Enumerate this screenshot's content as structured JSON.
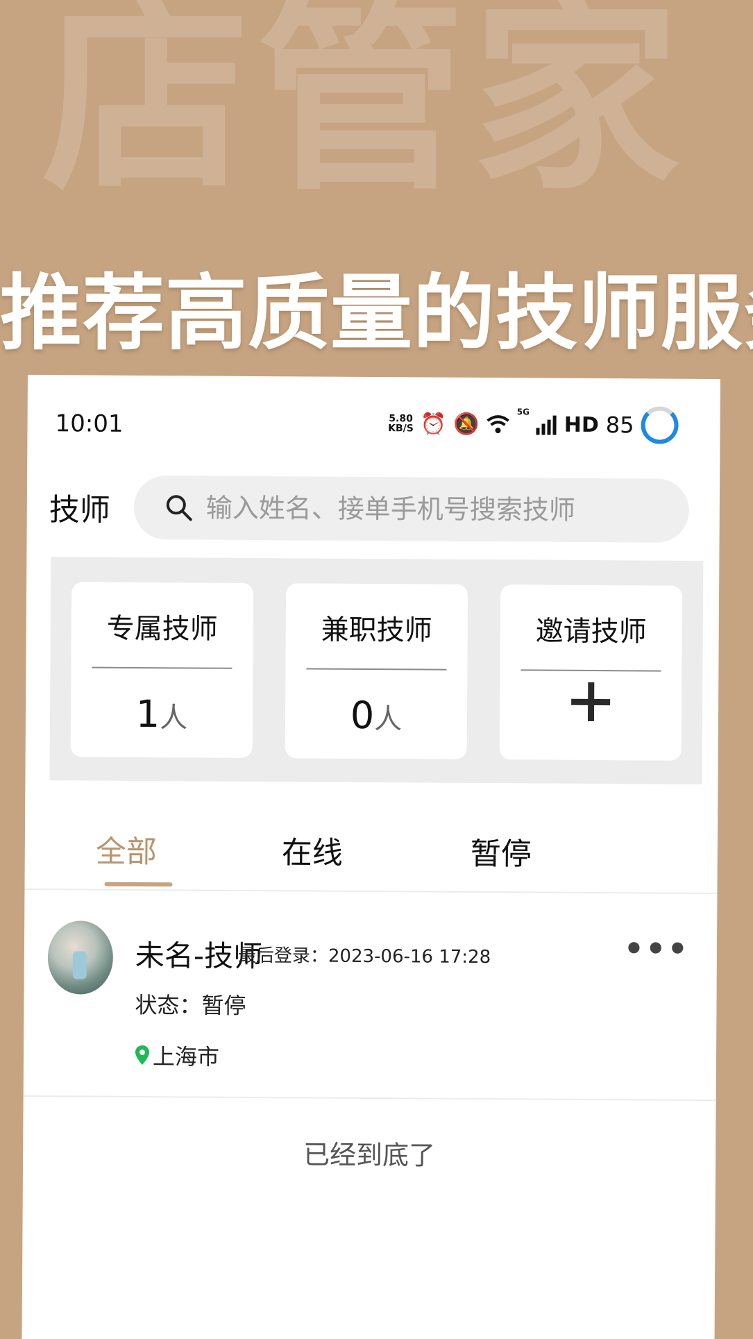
{
  "promo": {
    "watermark": "店管家",
    "headline": "推荐高质量的技师服务"
  },
  "status_bar": {
    "time": "10:01",
    "net_speed_value": "5.80",
    "net_speed_unit": "KB/S",
    "network": "5G",
    "hd": "HD",
    "battery": "85",
    "icons": [
      "alarm-icon",
      "silent-bell-icon",
      "wifi-icon",
      "signal-icon",
      "battery-ring-icon"
    ]
  },
  "header": {
    "title": "技师",
    "search_placeholder": "输入姓名、接单手机号搜索技师"
  },
  "stats": {
    "exclusive": {
      "label": "专属技师",
      "value": "1",
      "unit": "人"
    },
    "part_time": {
      "label": "兼职技师",
      "value": "0",
      "unit": "人"
    },
    "invite": {
      "label": "邀请技师"
    }
  },
  "tabs": [
    {
      "label": "全部",
      "active": true
    },
    {
      "label": "在线",
      "active": false
    },
    {
      "label": "暂停",
      "active": false
    }
  ],
  "technicians": [
    {
      "name": "未名-技师",
      "last_login_label": "最后登录：",
      "last_login": "2023-06-16 17:28",
      "status_text": "状态：暂停",
      "location": "上海市"
    }
  ],
  "list_end_text": "已经到底了",
  "colors": {
    "background": "#c6a482",
    "accent": "#c7a47f",
    "active_tab": "#b89570",
    "location_pin": "#1db954",
    "battery_ring": "#1e88e5"
  }
}
